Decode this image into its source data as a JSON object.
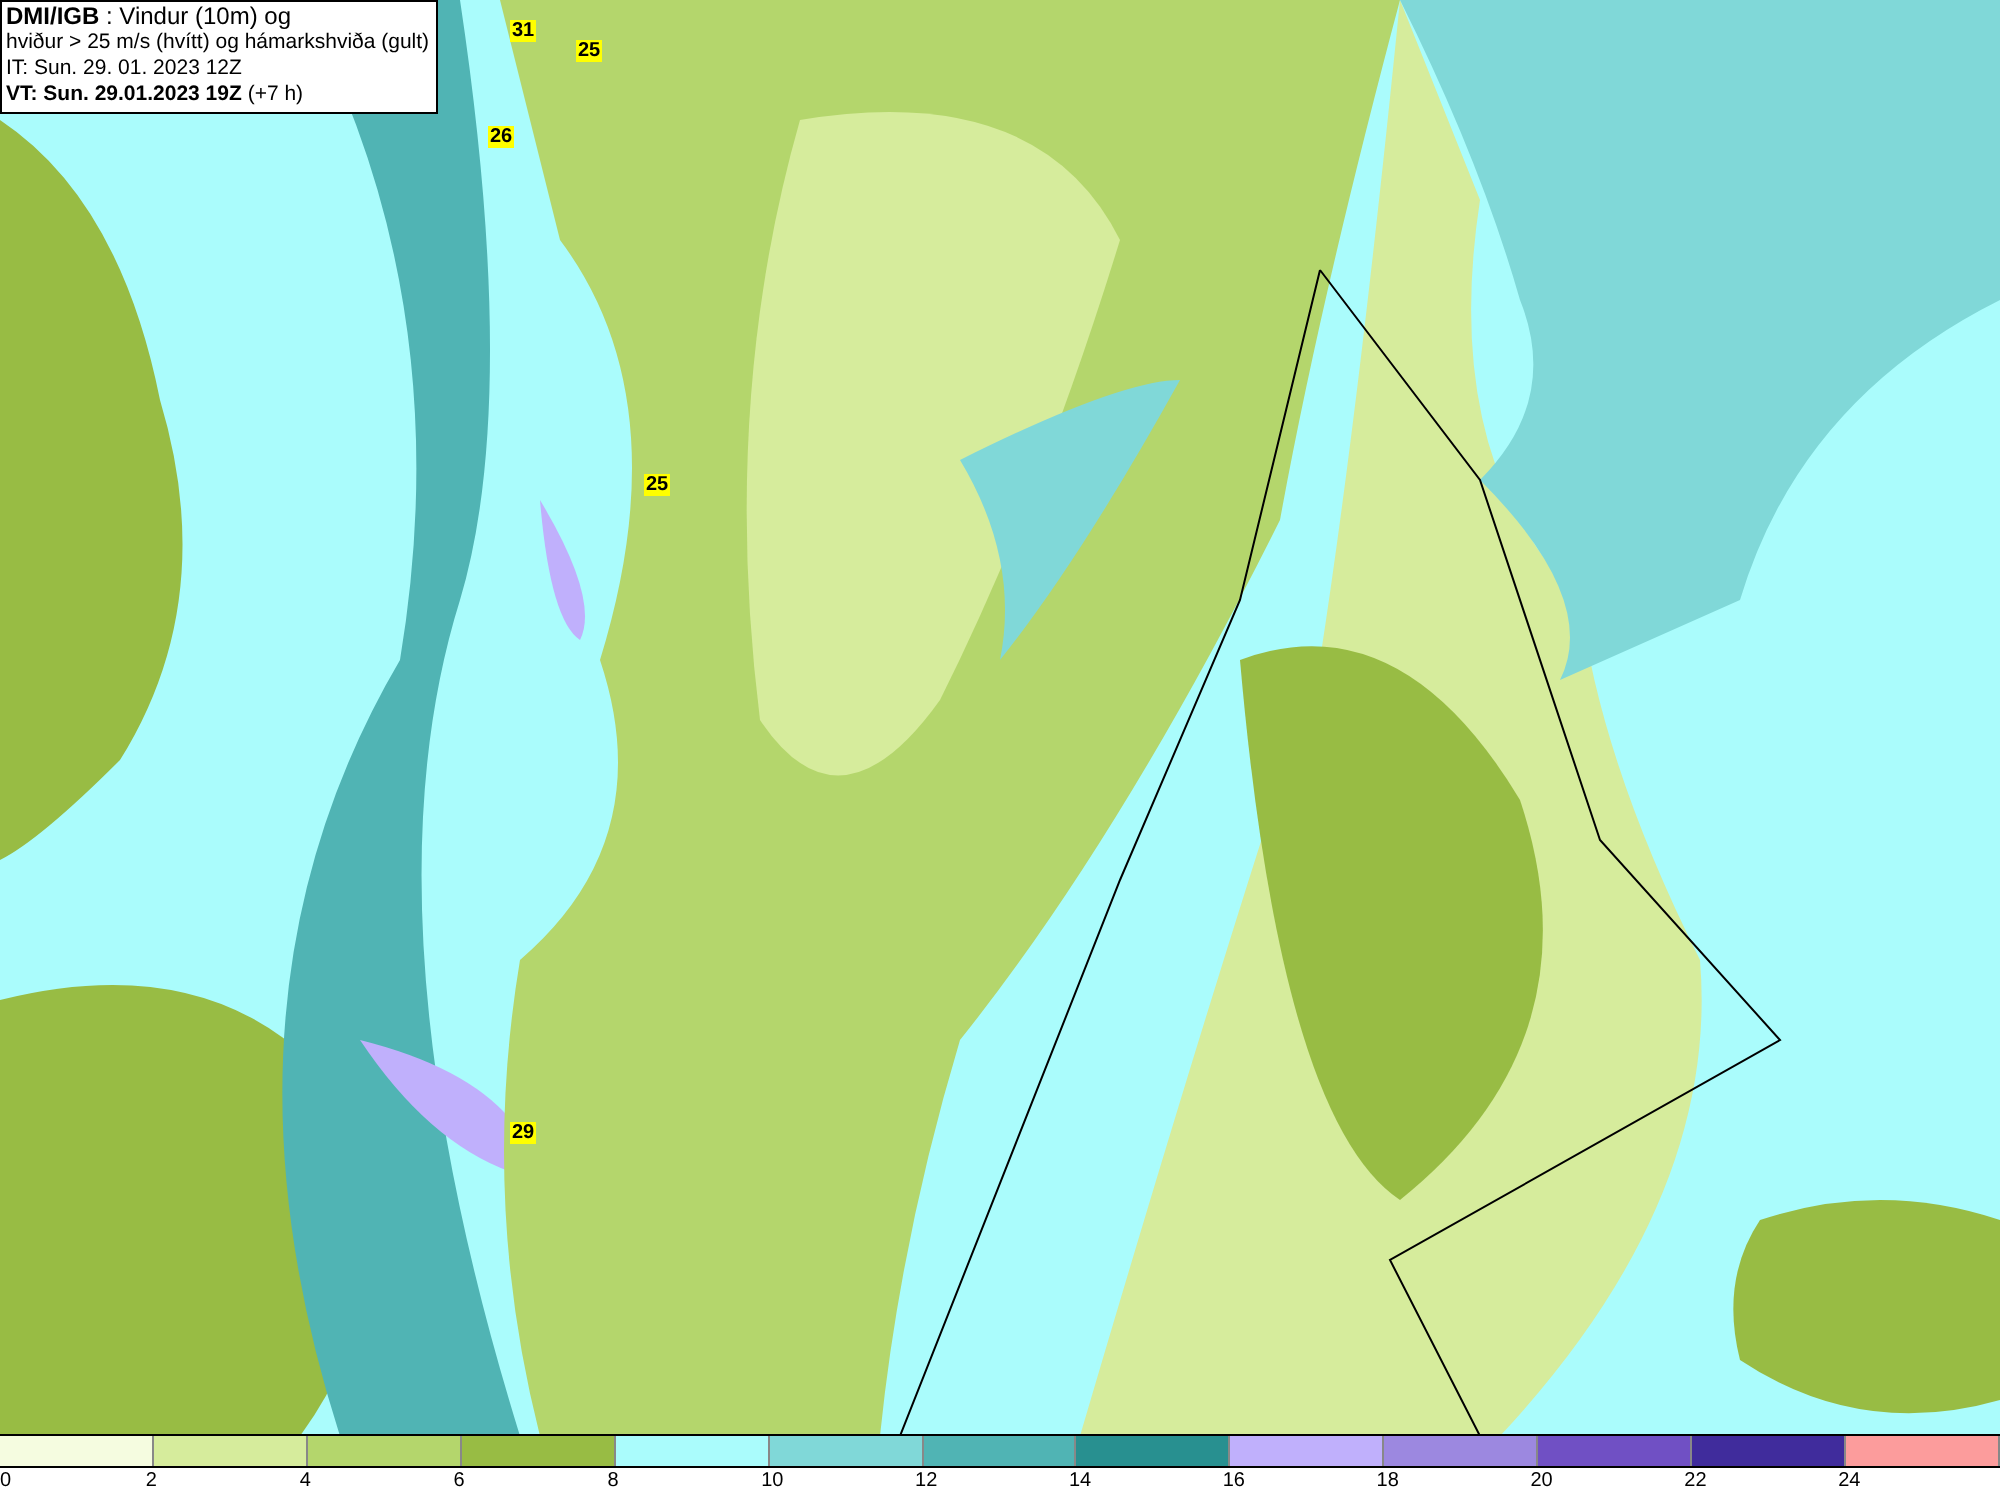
{
  "header": {
    "lines": [
      "**DMI/IGB** : Vindur (10m) og",
      "hviður > 25 m/s (hvítt) og hámarkshviða (gult)",
      "IT: Sun. 29. 01. 2023 12Z",
      "**VT: Sun. 29.01.2023 19Z** (+7 h)"
    ]
  },
  "map": {
    "gust_labels": [
      {
        "value": "31"
      },
      {
        "value": "25"
      },
      {
        "value": "26"
      },
      {
        "value": "25"
      },
      {
        "value": "29"
      }
    ]
  },
  "legend": [
    {
      "color": "#f5fce0",
      "label": "0"
    },
    {
      "color": "#d6ec9c",
      "label": "2"
    },
    {
      "color": "#b4d66c",
      "label": "4"
    },
    {
      "color": "#98bc44",
      "label": "6"
    },
    {
      "color": "#aafcfc",
      "label": "8"
    },
    {
      "color": "#80d8d8",
      "label": "10"
    },
    {
      "color": "#50b4b4",
      "label": "12"
    },
    {
      "color": "#289090",
      "label": "14"
    },
    {
      "color": "#c0b0fc",
      "label": "16"
    },
    {
      "color": "#9c88e0",
      "label": "18"
    },
    {
      "color": "#7050c4",
      "label": "20"
    },
    {
      "color": "#402c9c",
      "label": "22"
    },
    {
      "color": "#fc9c9c",
      "label": "24"
    }
  ]
}
